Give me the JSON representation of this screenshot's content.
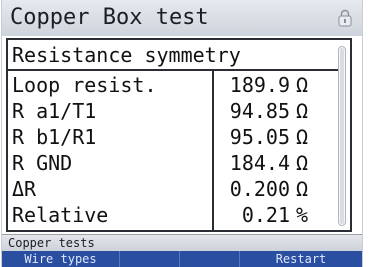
{
  "header": {
    "title": "Copper Box test",
    "status_icon": "lock-icon"
  },
  "panel": {
    "subtitle": "Resistance symmetry",
    "rows": [
      {
        "label": "Loop resist.",
        "value": "189.9",
        "unit": "Ω"
      },
      {
        "label": "R a1/T1",
        "value": "94.85",
        "unit": "Ω"
      },
      {
        "label": "R b1/R1",
        "value": "95.05",
        "unit": "Ω"
      },
      {
        "label": "R GND",
        "value": "184.4",
        "unit": "Ω"
      },
      {
        "label": "ΔR",
        "value": "0.200",
        "unit": "Ω"
      },
      {
        "label": "Relative",
        "value": "0.21",
        "unit": "%"
      }
    ]
  },
  "statusbar": {
    "text": "Copper tests"
  },
  "softkeys": [
    {
      "label": "Wire types"
    },
    {
      "label": ""
    },
    {
      "label": ""
    },
    {
      "label": "Restart"
    }
  ],
  "colors": {
    "softkey_bar": "#2b4fa0",
    "softkey_text": "#dfe6ff",
    "titlebar": "#dde1e7",
    "border": "#2a2d33"
  }
}
